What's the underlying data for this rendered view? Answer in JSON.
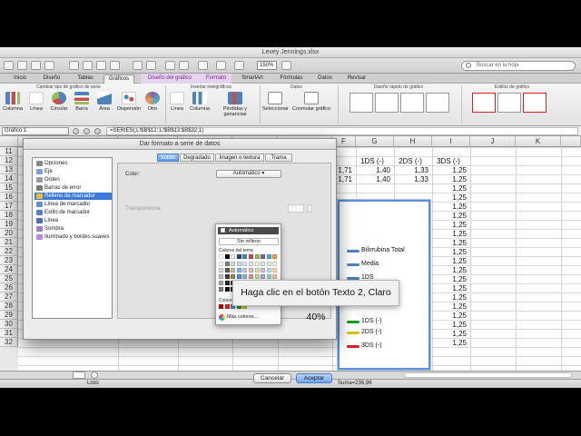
{
  "window": {
    "title": "Levey Jennings.xlsx"
  },
  "search": {
    "placeholder": "Buscar en la hoja"
  },
  "toolbar": {
    "zoom": "150%"
  },
  "tabs": [
    {
      "label": "Inicio"
    },
    {
      "label": "Diseño"
    },
    {
      "label": "Tablas"
    },
    {
      "label": "Gráficos"
    },
    {
      "label": "Diseño del gráfico"
    },
    {
      "label": "Formato"
    },
    {
      "label": "SmartArt"
    },
    {
      "label": "Fórmulas"
    },
    {
      "label": "Datos"
    },
    {
      "label": "Revisar"
    }
  ],
  "ribbon": {
    "groups": [
      "Cambiar tipo de gráfico de serie",
      "Insertar minigráficos",
      "Datos",
      "Diseño rápido de gráfico",
      "Estilos de gráfico"
    ],
    "buttons": [
      "Columna",
      "Línea",
      "Circular",
      "Barra",
      "Área",
      "Dispersión",
      "Otro",
      "Línea",
      "Columna",
      "Pérdidas y ganancias",
      "Seleccionar",
      "Conmutar gráfico"
    ]
  },
  "formula_bar": {
    "name_box": "Gráfico 1",
    "formula": "=SERIES(;L!$B$12:;L!$B$13:$B$32;1)"
  },
  "grid": {
    "columns": [
      "A",
      "B",
      "C",
      "D",
      "E",
      "F",
      "G",
      "H",
      "I",
      "J",
      "K"
    ],
    "rows": [
      "11",
      "12",
      "13",
      "14",
      "15",
      "16",
      "17",
      "18",
      "19",
      "20",
      "21",
      "22",
      "23",
      "24",
      "25",
      "26",
      "27",
      "28",
      "29",
      "30",
      "31",
      "32"
    ],
    "headers_row12": [
      "1DS (-)",
      "2DS (-)",
      "3DS (-)"
    ],
    "col_f_partial": [
      "1,71",
      "1,71",
      "1,71",
      "1,71"
    ],
    "col_g": [
      "1,40",
      "1,40",
      "1,40",
      "1,40"
    ],
    "col_h": [
      "1,33",
      "1,33",
      "1,33",
      "1,33"
    ],
    "col_i": [
      "1,25",
      "1,25",
      "1,25",
      "1,25",
      "1,25",
      "1,25",
      "1,25",
      "1,25",
      "1,25",
      "1,25",
      "1,25",
      "1,25",
      "1,25",
      "1,25",
      "1,25",
      "1,25",
      "1,25",
      "1,25",
      "1,25",
      "1,25"
    ],
    "partial_label": "20"
  },
  "chart": {
    "legend": [
      {
        "name": "Bilirrubina Total",
        "color": "#4f81bd"
      },
      {
        "name": "Media",
        "color": "#4f81bd"
      },
      {
        "name": "1DS",
        "color": "#4f81bd"
      },
      {
        "name": "1DS (-)",
        "color": "#1a9c1a"
      },
      {
        "name": "2DS (-)",
        "color": "#d6c514"
      },
      {
        "name": "3DS (-)",
        "color": "#d62020"
      }
    ]
  },
  "status": {
    "ready": "Listo",
    "sum": "Suma=236,96"
  },
  "dialog": {
    "title": "Dar formato a serie de datos",
    "nav": [
      {
        "label": "Opciones",
        "color": "#8a8a8a"
      },
      {
        "label": "Eje",
        "color": "#7aa0d4"
      },
      {
        "label": "Orden",
        "color": "#9a9a9a"
      },
      {
        "label": "Barras de error",
        "color": "#7a7a7a"
      },
      {
        "label": "Relleno de marcador",
        "color": "#f0c030"
      },
      {
        "label": "Línea de marcador",
        "color": "#6a8fd0"
      },
      {
        "label": "Estilo de marcador",
        "color": "#5a7fc0"
      },
      {
        "label": "Línea",
        "color": "#4a70b8"
      },
      {
        "label": "Sombra",
        "color": "#9c7cc8"
      },
      {
        "label": "Iluminado y bordes suaves",
        "color": "#b58ad8"
      }
    ],
    "selected_index": 4,
    "subtabs": [
      "Sólido",
      "Degradado",
      "Imagen o textura",
      "Trama"
    ],
    "color_label": "Color:",
    "color_value": "Automático",
    "transparency_label": "Transparencia:",
    "cancel": "Cancelar",
    "ok": "Aceptar"
  },
  "color_popup": {
    "automatic": "Automático",
    "no_fill": "Sin relleno",
    "theme_label": "Colores del tema",
    "recent_label": "Colores",
    "more": "Más colores...",
    "theme_top": [
      "#ffffff",
      "#000000",
      "#eeece1",
      "#1f497d",
      "#4f81bd",
      "#c0504d",
      "#9bbb59",
      "#8064a2",
      "#4bacc6",
      "#f79646"
    ],
    "theme_tints": [
      [
        "#f2f2f2",
        "#7f7f7f",
        "#ddd9c3",
        "#c6d9f0",
        "#dbe5f1",
        "#f2dcdb",
        "#ebf1dd",
        "#e5e0ec",
        "#dbeef3",
        "#fdeada"
      ],
      [
        "#d8d8d8",
        "#595959",
        "#c4bd97",
        "#8db3e2",
        "#b8cce4",
        "#e5b9b7",
        "#d7e3bc",
        "#ccc1d9",
        "#b7dde8",
        "#fbd5b5"
      ],
      [
        "#bfbfbf",
        "#3f3f3f",
        "#938953",
        "#548dd4",
        "#95b3d7",
        "#d99694",
        "#c3d69b",
        "#b2a2c7",
        "#92cddc",
        "#fac08f"
      ],
      [
        "#a5a5a5",
        "#262626",
        "#494429",
        "#17365d",
        "#366092",
        "#953734",
        "#76923c",
        "#5f497a",
        "#31859b",
        "#e36c09"
      ],
      [
        "#7f7f7f",
        "#0c0c0c",
        "#1d1b10",
        "#0f243e",
        "#244061",
        "#632423",
        "#4f6128",
        "#3f3151",
        "#205867",
        "#974806"
      ]
    ],
    "recent": [
      "#c00000",
      "#d62020",
      "#4f81bd",
      "#1a9c1a",
      "#d6c514"
    ]
  },
  "tooltip": {
    "text": "Haga clic en el botón Texto 2, Claro 40%"
  }
}
